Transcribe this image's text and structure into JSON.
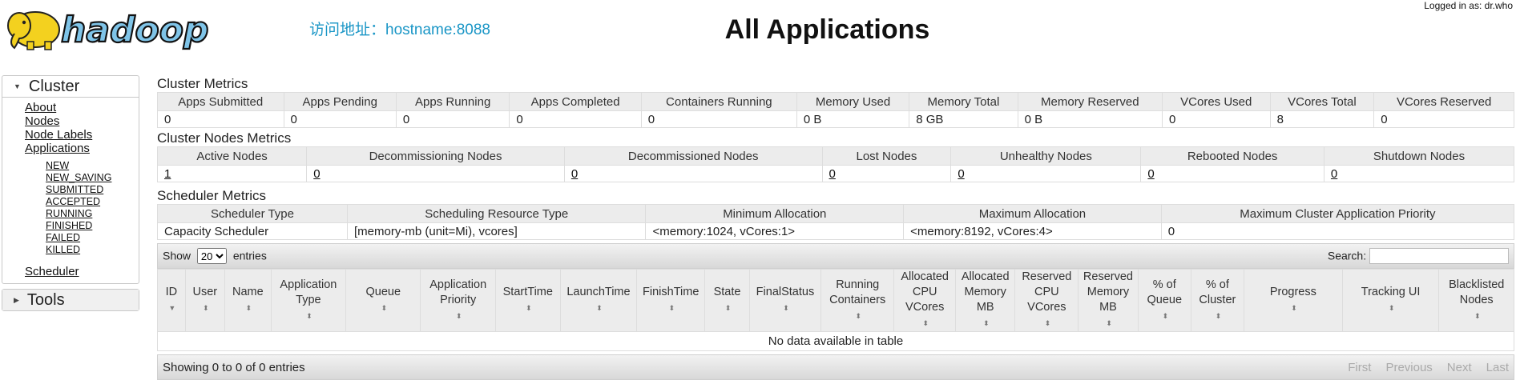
{
  "header": {
    "logged_in": "Logged in as: dr.who",
    "logo_text": "hadoop",
    "access_address": "访问地址：hostname:8088",
    "title": "All Applications"
  },
  "sidebar": {
    "cluster_label": "Cluster",
    "links": [
      "About",
      "Nodes",
      "Node Labels",
      "Applications"
    ],
    "app_states": [
      "NEW",
      "NEW_SAVING",
      "SUBMITTED",
      "ACCEPTED",
      "RUNNING",
      "FINISHED",
      "FAILED",
      "KILLED"
    ],
    "scheduler_label": "Scheduler",
    "tools_label": "Tools"
  },
  "cluster_metrics": {
    "title": "Cluster Metrics",
    "headers": [
      "Apps Submitted",
      "Apps Pending",
      "Apps Running",
      "Apps Completed",
      "Containers Running",
      "Memory Used",
      "Memory Total",
      "Memory Reserved",
      "VCores Used",
      "VCores Total",
      "VCores Reserved"
    ],
    "values": [
      "0",
      "0",
      "0",
      "0",
      "0",
      "0 B",
      "8 GB",
      "0 B",
      "0",
      "8",
      "0"
    ]
  },
  "nodes_metrics": {
    "title": "Cluster Nodes Metrics",
    "headers": [
      "Active Nodes",
      "Decommissioning Nodes",
      "Decommissioned Nodes",
      "Lost Nodes",
      "Unhealthy Nodes",
      "Rebooted Nodes",
      "Shutdown Nodes"
    ],
    "values": [
      "1",
      "0",
      "0",
      "0",
      "0",
      "0",
      "0"
    ]
  },
  "scheduler_metrics": {
    "title": "Scheduler Metrics",
    "headers": [
      "Scheduler Type",
      "Scheduling Resource Type",
      "Minimum Allocation",
      "Maximum Allocation",
      "Maximum Cluster Application Priority"
    ],
    "values": [
      "Capacity Scheduler",
      "[memory-mb (unit=Mi), vcores]",
      "<memory:1024, vCores:1>",
      "<memory:8192, vCores:4>",
      "0"
    ]
  },
  "apps_table": {
    "show_label": "Show",
    "entries_label": "entries",
    "page_size": "20",
    "search_label": "Search:",
    "columns": [
      {
        "l1": "ID",
        "l2": ""
      },
      {
        "l1": "User",
        "l2": ""
      },
      {
        "l1": "Name",
        "l2": ""
      },
      {
        "l1": "Application",
        "l2": "Type"
      },
      {
        "l1": "Queue",
        "l2": ""
      },
      {
        "l1": "Application",
        "l2": "Priority"
      },
      {
        "l1": "StartTime",
        "l2": ""
      },
      {
        "l1": "LaunchTime",
        "l2": ""
      },
      {
        "l1": "FinishTime",
        "l2": ""
      },
      {
        "l1": "State",
        "l2": ""
      },
      {
        "l1": "FinalStatus",
        "l2": ""
      },
      {
        "l1": "Running",
        "l2": "Containers"
      },
      {
        "l1": "Allocated",
        "l2": "CPU",
        "l3": "VCores"
      },
      {
        "l1": "Allocated",
        "l2": "Memory",
        "l3": "MB"
      },
      {
        "l1": "Reserved",
        "l2": "CPU",
        "l3": "VCores"
      },
      {
        "l1": "Reserved",
        "l2": "Memory",
        "l3": "MB"
      },
      {
        "l1": "% of",
        "l2": "Queue"
      },
      {
        "l1": "% of",
        "l2": "Cluster"
      },
      {
        "l1": "Progress",
        "l2": ""
      },
      {
        "l1": "Tracking UI",
        "l2": ""
      },
      {
        "l1": "Blacklisted",
        "l2": "Nodes"
      }
    ],
    "empty_text": "No data available in table",
    "footer_info": "Showing 0 to 0 of 0 entries",
    "pager": [
      "First",
      "Previous",
      "Next",
      "Last"
    ]
  },
  "colors": {
    "access_text": "#1a96c6",
    "logo_blue": "#7fc4e8",
    "elephant_yellow": "#f3d11f"
  },
  "icons": {
    "expand": "triangle-down-icon",
    "collapsed": "triangle-right-icon",
    "sort": "sort-icon"
  }
}
